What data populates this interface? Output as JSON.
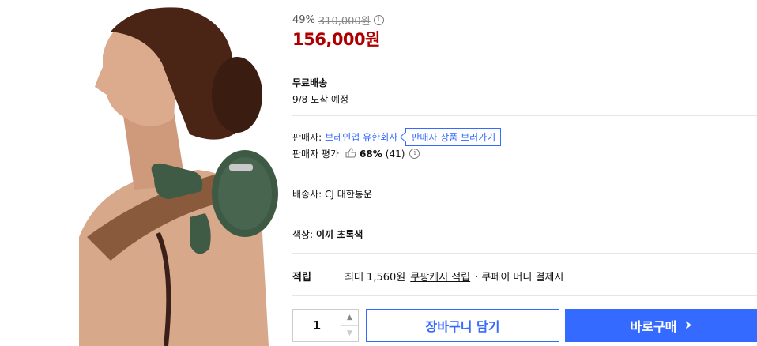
{
  "product": {
    "image_alt": "product model"
  },
  "price": {
    "discount": "49%",
    "original": "310,000원",
    "sale": "156,000원",
    "info_icon": "i"
  },
  "shipping": {
    "title": "무료배송",
    "arrival": "9/8 도착 예정"
  },
  "seller": {
    "label": "판매자:",
    "name": "브레인업 유한회사",
    "view_products": "판매자 상품 보러가기",
    "rating_label": "판매자 평가",
    "rating_pct": "68%",
    "rating_count": "(41)"
  },
  "carrier": {
    "label": "배송사:",
    "name": "CJ 대한통운"
  },
  "color": {
    "label": "색상:",
    "value": "이끼 초록색"
  },
  "reward": {
    "label": "적립",
    "max_text": "최대 1,560원",
    "link": "쿠팡캐시 적립",
    "suffix": "· 쿠페이 머니 결제시"
  },
  "purchase": {
    "quantity": "1",
    "cart_label": "장바구니 담기",
    "buy_label": "바로구매",
    "buy_arrow": "›"
  },
  "colors": {
    "accent": "#346aff",
    "price_red": "#ae0000"
  }
}
